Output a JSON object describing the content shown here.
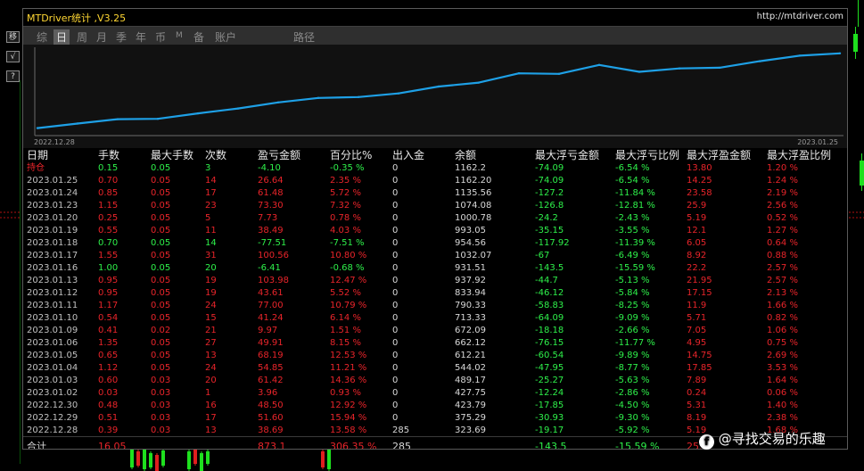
{
  "side_buttons": [
    "移",
    "√",
    "?"
  ],
  "window": {
    "title": "MTDriver统计 ,V3.25",
    "url": "http://mtdriver.com"
  },
  "tabs": [
    {
      "label": "综",
      "active": false
    },
    {
      "label": "日",
      "active": true
    },
    {
      "label": "周",
      "active": false
    },
    {
      "label": "月",
      "active": false
    },
    {
      "label": "季",
      "active": false
    },
    {
      "label": "年",
      "active": false
    },
    {
      "label": "币",
      "active": false
    },
    {
      "label": "M",
      "active": false
    },
    {
      "label": "备",
      "active": false
    },
    {
      "label": "账户",
      "active": false
    },
    {
      "label": "路径",
      "active": false
    }
  ],
  "chart_data": {
    "type": "line",
    "x_start_label": "2022.12.28",
    "x_end_label": "2023.01.25",
    "line_color": "#1ea0e6",
    "x": [
      "2022.12.28",
      "2022.12.29",
      "2022.12.30",
      "2023.01.02",
      "2023.01.03",
      "2023.01.04",
      "2023.01.05",
      "2023.01.06",
      "2023.01.09",
      "2023.01.10",
      "2023.01.11",
      "2023.01.12",
      "2023.01.13",
      "2023.01.16",
      "2023.01.17",
      "2023.01.18",
      "2023.01.19",
      "2023.01.20",
      "2023.01.23",
      "2023.01.24",
      "2023.01.25"
    ],
    "values": [
      323.69,
      375.29,
      423.79,
      427.75,
      489.17,
      544.02,
      612.21,
      662.12,
      672.09,
      713.33,
      790.33,
      833.94,
      937.92,
      931.51,
      1032.07,
      954.56,
      993.05,
      1000.78,
      1074.08,
      1135.56,
      1162.2
    ],
    "ylim": [
      260,
      1200
    ]
  },
  "table": {
    "headers": [
      "日期",
      "手数",
      "最大手数",
      "次数",
      "盈亏金额",
      "百分比%",
      "出入金",
      "余额",
      "最大浮亏金额",
      "最大浮亏比例",
      "最大浮盈金额",
      "最大浮盈比例"
    ],
    "colors": {
      "header": "#e8e8e8",
      "label": "#c0c0c0",
      "positive": "#e8242a",
      "negative": "#2ef04a",
      "neutral": "#d8d8d8"
    },
    "position_row": {
      "tone": "negative",
      "cells": [
        "持仓",
        "0.15",
        "0.05",
        "3",
        "-4.10",
        "-0.35 %",
        "0",
        "1162.2",
        "-74.09",
        "-6.54 %",
        "13.80",
        "1.20 %"
      ]
    },
    "rows": [
      {
        "tone": "positive",
        "cells": [
          "2023.01.25",
          "0.70",
          "0.05",
          "14",
          "26.64",
          "2.35 %",
          "0",
          "1162.20",
          "-74.09",
          "-6.54 %",
          "14.25",
          "1.24 %"
        ]
      },
      {
        "tone": "positive",
        "cells": [
          "2023.01.24",
          "0.85",
          "0.05",
          "17",
          "61.48",
          "5.72 %",
          "0",
          "1135.56",
          "-127.2",
          "-11.84 %",
          "23.58",
          "2.19 %"
        ]
      },
      {
        "tone": "positive",
        "cells": [
          "2023.01.23",
          "1.15",
          "0.05",
          "23",
          "73.30",
          "7.32 %",
          "0",
          "1074.08",
          "-126.8",
          "-12.81 %",
          "25.9",
          "2.56 %"
        ]
      },
      {
        "tone": "positive",
        "cells": [
          "2023.01.20",
          "0.25",
          "0.05",
          "5",
          "7.73",
          "0.78 %",
          "0",
          "1000.78",
          "-24.2",
          "-2.43 %",
          "5.19",
          "0.52 %"
        ]
      },
      {
        "tone": "positive",
        "cells": [
          "2023.01.19",
          "0.55",
          "0.05",
          "11",
          "38.49",
          "4.03 %",
          "0",
          "993.05",
          "-35.15",
          "-3.55 %",
          "12.1",
          "1.27 %"
        ]
      },
      {
        "tone": "negative",
        "cells": [
          "2023.01.18",
          "0.70",
          "0.05",
          "14",
          "-77.51",
          "-7.51 %",
          "0",
          "954.56",
          "-117.92",
          "-11.39 %",
          "6.05",
          "0.64 %"
        ]
      },
      {
        "tone": "positive",
        "cells": [
          "2023.01.17",
          "1.55",
          "0.05",
          "31",
          "100.56",
          "10.80 %",
          "0",
          "1032.07",
          "-67",
          "-6.49 %",
          "8.92",
          "0.88 %"
        ]
      },
      {
        "tone": "negative",
        "cells": [
          "2023.01.16",
          "1.00",
          "0.05",
          "20",
          "-6.41",
          "-0.68 %",
          "0",
          "931.51",
          "-143.5",
          "-15.59 %",
          "22.2",
          "2.57 %"
        ]
      },
      {
        "tone": "positive",
        "cells": [
          "2023.01.13",
          "0.95",
          "0.05",
          "19",
          "103.98",
          "12.47 %",
          "0",
          "937.92",
          "-44.7",
          "-5.13 %",
          "21.95",
          "2.57 %"
        ]
      },
      {
        "tone": "positive",
        "cells": [
          "2023.01.12",
          "0.95",
          "0.05",
          "19",
          "43.61",
          "5.52 %",
          "0",
          "833.94",
          "-46.12",
          "-5.84 %",
          "17.15",
          "2.13 %"
        ]
      },
      {
        "tone": "positive",
        "cells": [
          "2023.01.11",
          "1.17",
          "0.05",
          "24",
          "77.00",
          "10.79 %",
          "0",
          "790.33",
          "-58.83",
          "-8.25 %",
          "11.9",
          "1.66 %"
        ]
      },
      {
        "tone": "positive",
        "cells": [
          "2023.01.10",
          "0.54",
          "0.05",
          "15",
          "41.24",
          "6.14 %",
          "0",
          "713.33",
          "-64.09",
          "-9.09 %",
          "5.71",
          "0.82 %"
        ]
      },
      {
        "tone": "positive",
        "cells": [
          "2023.01.09",
          "0.41",
          "0.02",
          "21",
          "9.97",
          "1.51 %",
          "0",
          "672.09",
          "-18.18",
          "-2.66 %",
          "7.05",
          "1.06 %"
        ]
      },
      {
        "tone": "positive",
        "cells": [
          "2023.01.06",
          "1.35",
          "0.05",
          "27",
          "49.91",
          "8.15 %",
          "0",
          "662.12",
          "-76.15",
          "-11.77 %",
          "4.95",
          "0.75 %"
        ]
      },
      {
        "tone": "positive",
        "cells": [
          "2023.01.05",
          "0.65",
          "0.05",
          "13",
          "68.19",
          "12.53 %",
          "0",
          "612.21",
          "-60.54",
          "-9.89 %",
          "14.75",
          "2.69 %"
        ]
      },
      {
        "tone": "positive",
        "cells": [
          "2023.01.04",
          "1.12",
          "0.05",
          "24",
          "54.85",
          "11.21 %",
          "0",
          "544.02",
          "-47.95",
          "-8.77 %",
          "17.85",
          "3.53 %"
        ]
      },
      {
        "tone": "positive",
        "cells": [
          "2023.01.03",
          "0.60",
          "0.03",
          "20",
          "61.42",
          "14.36 %",
          "0",
          "489.17",
          "-25.27",
          "-5.63 %",
          "7.89",
          "1.64 %"
        ]
      },
      {
        "tone": "positive",
        "cells": [
          "2023.01.02",
          "0.03",
          "0.03",
          "1",
          "3.96",
          "0.93 %",
          "0",
          "427.75",
          "-12.24",
          "-2.86 %",
          "0.24",
          "0.06 %"
        ]
      },
      {
        "tone": "positive",
        "cells": [
          "2022.12.30",
          "0.48",
          "0.03",
          "16",
          "48.50",
          "12.92 %",
          "0",
          "423.79",
          "-17.85",
          "-4.50 %",
          "5.31",
          "1.40 %"
        ]
      },
      {
        "tone": "positive",
        "cells": [
          "2022.12.29",
          "0.51",
          "0.03",
          "17",
          "51.60",
          "15.94 %",
          "0",
          "375.29",
          "-30.93",
          "-9.30 %",
          "8.19",
          "2.38 %"
        ]
      },
      {
        "tone": "positive",
        "cells": [
          "2022.12.28",
          "0.39",
          "0.03",
          "13",
          "38.69",
          "13.58 %",
          "285",
          "323.69",
          "-19.17",
          "-5.92 %",
          "5.19",
          "1.68 %"
        ]
      }
    ],
    "total_row": {
      "cells": [
        "合计",
        "16.05",
        "",
        "",
        "873.1",
        "306.35 %",
        "285",
        "",
        "-143.5",
        "-15.59 %",
        "25.",
        ""
      ]
    }
  },
  "watermark": {
    "icon": "f",
    "text": "@寻找交易的乐趣"
  }
}
